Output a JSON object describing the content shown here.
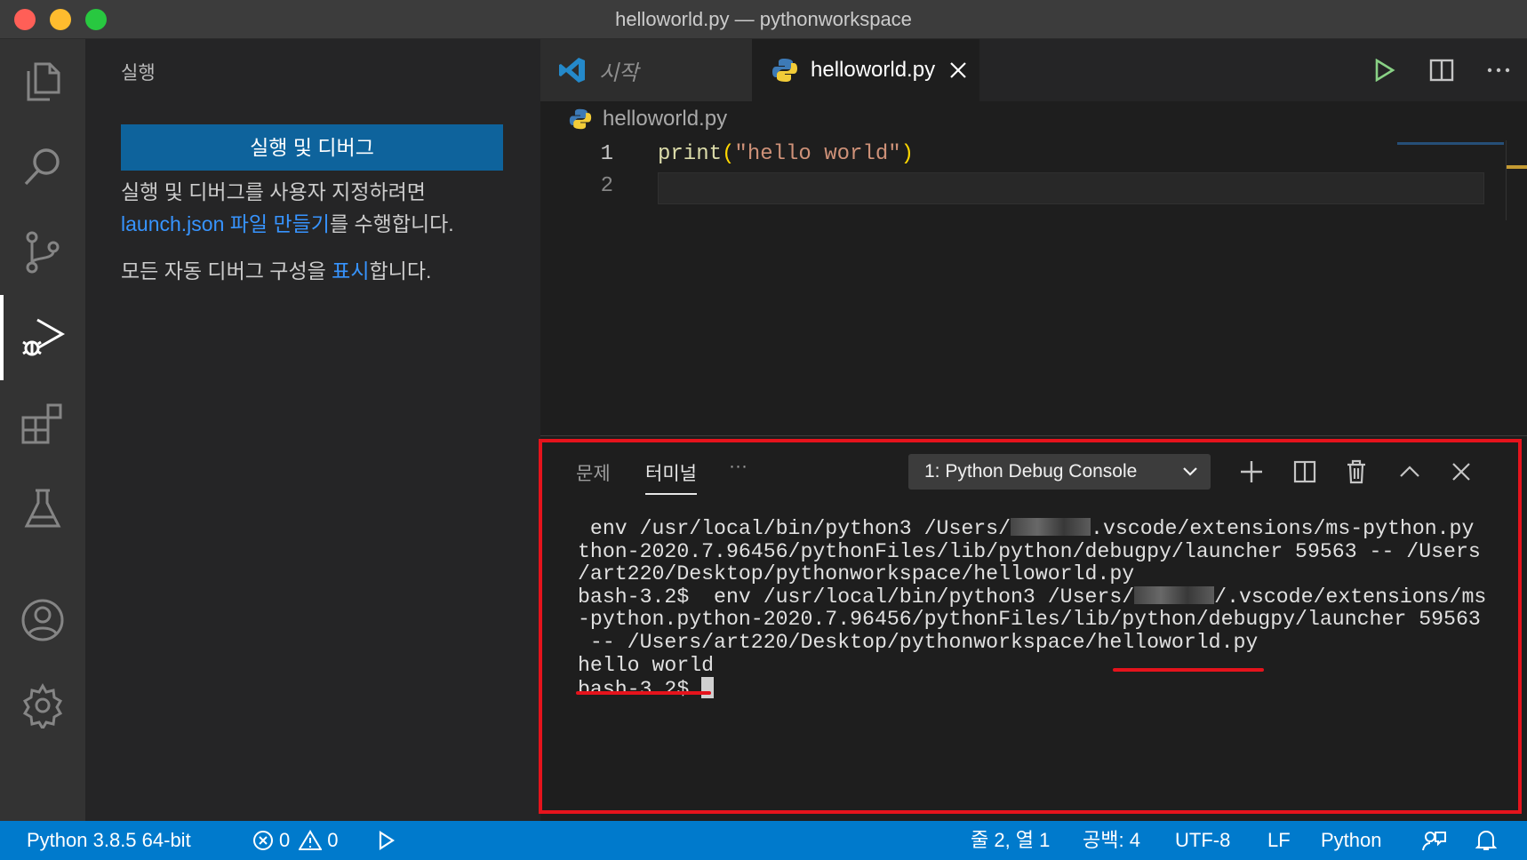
{
  "window": {
    "title": "helloworld.py — pythonworkspace"
  },
  "activity_bar": {
    "items": [
      "explorer-icon",
      "search-icon",
      "source-control-icon",
      "run-debug-icon",
      "extensions-icon",
      "testing-icon",
      "accounts-icon",
      "manage-gear-icon"
    ],
    "active": "run-debug-icon"
  },
  "sidebar": {
    "title": "실행",
    "run_button": "실행 및 디버그",
    "para1_text": "실행 및 디버그를 사용자 지정하려면",
    "para1_link": "launch.json 파일 만들기",
    "para1_suffix": "를 수행합니다.",
    "para2_prefix": "모든 자동 디버그 구성을 ",
    "para2_link": "표시",
    "para2_suffix": "합니다."
  },
  "tabs": [
    {
      "label": "시작",
      "active": false
    },
    {
      "label": "helloworld.py",
      "active": true
    }
  ],
  "breadcrumb": {
    "file": "helloworld.py"
  },
  "editor": {
    "line_numbers": [
      "1",
      "2"
    ],
    "code": {
      "fn": "print",
      "open": "(",
      "str": "\"hello world\"",
      "close": ")"
    }
  },
  "panel": {
    "tabs": {
      "problems": "문제",
      "terminal": "터미널",
      "more": "···"
    },
    "terminal_select": "1: Python Debug Console",
    "lines": {
      "l1a": " env /usr/local/bin/python3 /Users/",
      "l1b": ".vscode/extensions/ms-python.py",
      "l2": "thon-2020.7.96456/pythonFiles/lib/python/debugpy/launcher 59563 -- /Users",
      "l3": "/art220/Desktop/pythonworkspace/helloworld.py",
      "l4a": "bash-3.2$  env /usr/local/bin/python3 /Users/",
      "l4b": "/.vscode/extensions/ms",
      "l5": "-python.python-2020.7.96456/pythonFiles/lib/python/debugpy/launcher 59563",
      "l6": " -- /Users/art220/Desktop/pythonworkspace/helloworld.py",
      "l7": "hello world",
      "l8": "bash-3.2$ "
    }
  },
  "statusbar": {
    "interpreter": "Python 3.8.5 64-bit",
    "errors": "0",
    "warnings": "0",
    "position": "줄 2, 열 1",
    "spaces": "공백: 4",
    "encoding": "UTF-8",
    "eol": "LF",
    "language": "Python"
  },
  "colors": {
    "accent": "#007acc",
    "annotation": "#e5131c",
    "button": "#0e639c",
    "link": "#3794ff"
  }
}
